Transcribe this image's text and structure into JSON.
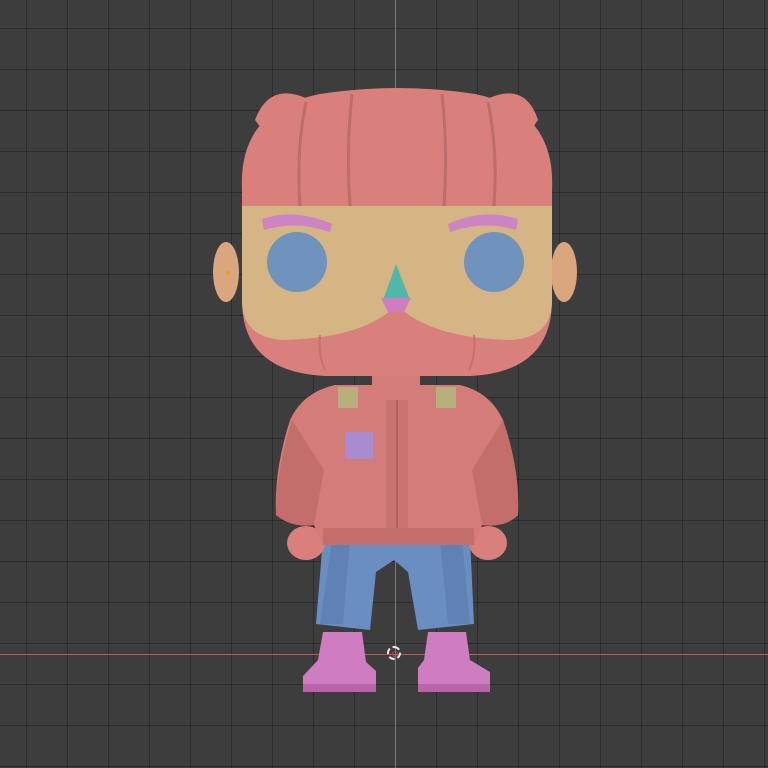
{
  "viewport": {
    "background_color": "#3d3d3d",
    "grid_color": "#2e2e2e",
    "y_axis_color": "#3f8fb8",
    "x_axis_color": "#b85c5a"
  },
  "model": {
    "parts": [
      {
        "name": "head",
        "color": "#d97f7c"
      },
      {
        "name": "face-visor",
        "color": "#d4b583"
      },
      {
        "name": "eyes",
        "color": "#6f93bd"
      },
      {
        "name": "eyebrows",
        "color": "#cc84c2"
      },
      {
        "name": "nose-cone",
        "color": "#4fb8a9"
      },
      {
        "name": "jacket",
        "color": "#d47c79"
      },
      {
        "name": "pocket",
        "color": "#a98bd2"
      },
      {
        "name": "shoulder-straps",
        "color": "#b8b07a"
      },
      {
        "name": "pants",
        "color": "#6b8ec0"
      },
      {
        "name": "boots",
        "color": "#cf7cc1"
      }
    ]
  },
  "origin_marker": {
    "icon": "3d-cursor-icon"
  }
}
